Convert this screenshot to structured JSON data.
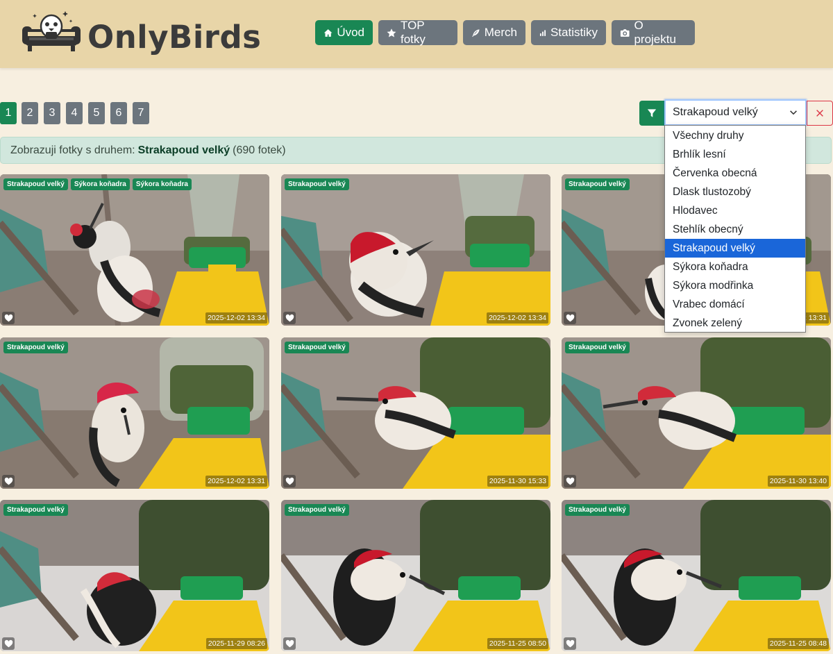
{
  "header": {
    "brand": "OnlyBirds",
    "nav": [
      {
        "label": "Úvod",
        "icon": "home-icon",
        "active": true
      },
      {
        "label": "TOP fotky",
        "icon": "star-icon",
        "active": false
      },
      {
        "label": "Merch",
        "icon": "feather-icon",
        "active": false
      },
      {
        "label": "Statistiky",
        "icon": "bar-chart-icon",
        "active": false
      },
      {
        "label": "O projektu",
        "icon": "camera-icon",
        "active": false
      }
    ]
  },
  "pagination": {
    "pages": [
      "1",
      "2",
      "3",
      "4",
      "5",
      "6",
      "7"
    ],
    "current": "1"
  },
  "filter": {
    "selected": "Strakapoud velký",
    "options": [
      "Všechny druhy",
      "Brhlík lesní",
      "Červenka obecná",
      "Dlask tlustozobý",
      "Hlodavec",
      "Stehlík obecný",
      "Strakapoud velký",
      "Sýkora koňadra",
      "Sýkora modřinka",
      "Vrabec domácí",
      "Zvonek zelený"
    ]
  },
  "alert": {
    "prefix": "Zobrazuji fotky s druhem:",
    "species": "Strakapoud velký",
    "count": "(690 fotek)"
  },
  "photos": [
    {
      "tags": [
        "Strakapoud velký",
        "Sýkora koňadra",
        "Sýkora koňadra"
      ],
      "timestamp": "2025-12-02 13:34"
    },
    {
      "tags": [
        "Strakapoud velký"
      ],
      "timestamp": "2025-12-02 13:34"
    },
    {
      "tags": [
        "Strakapoud velký"
      ],
      "timestamp": "2025-12-02 13:31"
    },
    {
      "tags": [
        "Strakapoud velký"
      ],
      "timestamp": "2025-12-02 13:31"
    },
    {
      "tags": [
        "Strakapoud velký"
      ],
      "timestamp": "2025-11-30 15:33"
    },
    {
      "tags": [
        "Strakapoud velký"
      ],
      "timestamp": "2025-11-30 13:40"
    },
    {
      "tags": [
        "Strakapoud velký"
      ],
      "timestamp": "2025-11-29 08:26"
    },
    {
      "tags": [
        "Strakapoud velký"
      ],
      "timestamp": "2025-11-25 08:50"
    },
    {
      "tags": [
        "Strakapoud velký"
      ],
      "timestamp": "2025-11-25 08:48"
    }
  ],
  "colors": {
    "accent": "#198754",
    "header_bg": "#e8d5a8",
    "page_bg": "#f7efe0",
    "muted_button": "#6c757d",
    "selected_option": "#1a66d9"
  }
}
